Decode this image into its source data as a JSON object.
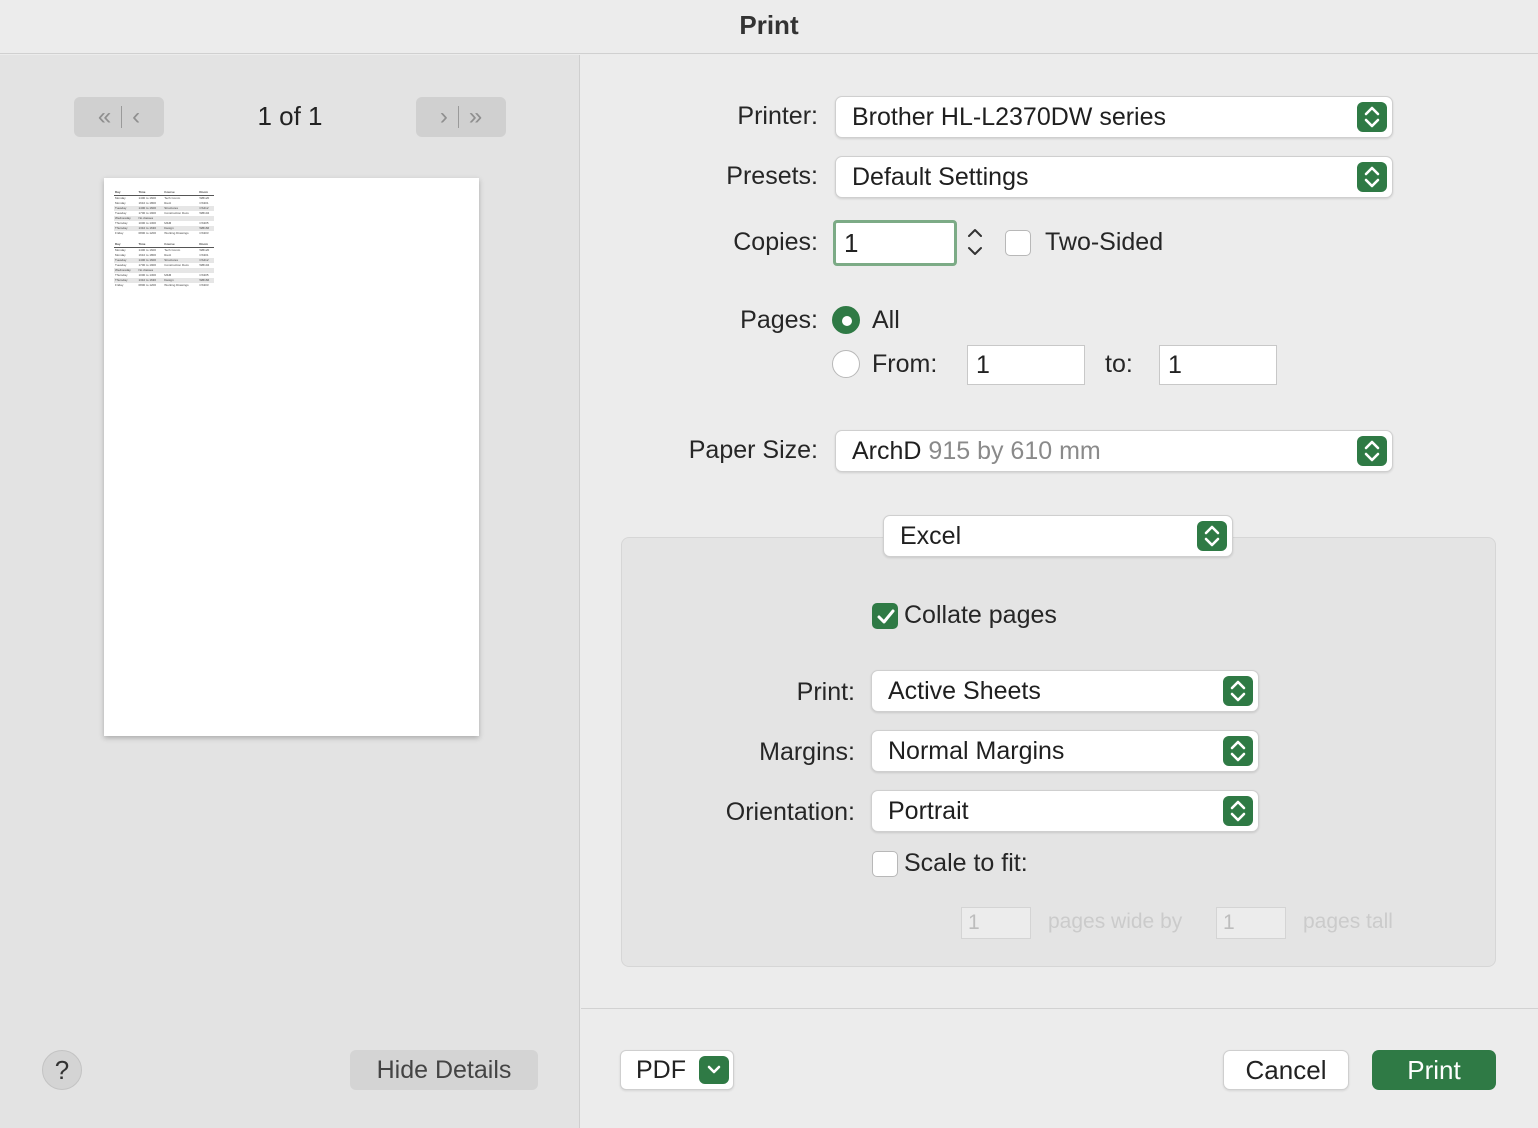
{
  "window": {
    "title": "Print"
  },
  "preview": {
    "page_indicator": "1 of 1",
    "table1": [
      [
        "Day",
        "Time",
        "Course",
        "Room"
      ],
      [
        "Monday",
        "1400 to 1600",
        "Tech Comm",
        "WB120"
      ],
      [
        "Monday",
        "1610 to 1800",
        "Revit",
        "CS301"
      ],
      [
        "Tuesday",
        "1400 to 1600",
        "Structures",
        "CS412"
      ],
      [
        "Tuesday",
        "1700 to 1900",
        "Construction Docs",
        "WB104"
      ],
      [
        "Wednesday",
        "No classes",
        "",
        ""
      ],
      [
        "Thursday",
        "1000 to 1300",
        "M&M",
        "CS305"
      ],
      [
        "Thursday",
        "1310 to 1630",
        "Design",
        "WB166"
      ],
      [
        "Friday",
        "0800 to 1200",
        "Working Drawings",
        "CS303"
      ]
    ],
    "table2": [
      [
        "Day",
        "Time",
        "Course",
        "Room"
      ],
      [
        "Monday",
        "1400 to 1600",
        "Tech Comm",
        "WB120"
      ],
      [
        "Monday",
        "1610 to 1800",
        "Revit",
        "CS301"
      ],
      [
        "Tuesday",
        "1400 to 1600",
        "Structures",
        "CS412"
      ],
      [
        "Tuesday",
        "1700 to 1900",
        "Construction Docs",
        "WB104"
      ],
      [
        "Wednesday",
        "No classes",
        "",
        ""
      ],
      [
        "Thursday",
        "1000 to 1300",
        "M&M",
        "CS305"
      ],
      [
        "Thursday",
        "1310 to 1630",
        "Design",
        "WB166"
      ],
      [
        "Friday",
        "0800 to 1200",
        "Working Drawings",
        "CS303"
      ]
    ]
  },
  "left_footer": {
    "help_label": "?",
    "hide_details_label": "Hide Details"
  },
  "form": {
    "printer_label": "Printer:",
    "printer_value": "Brother HL-L2370DW series",
    "presets_label": "Presets:",
    "presets_value": "Default Settings",
    "copies_label": "Copies:",
    "copies_value": "1",
    "two_sided_label": "Two-Sided",
    "pages_label": "Pages:",
    "pages_all": "All",
    "pages_from": "From:",
    "from_value": "1",
    "pages_to": "to:",
    "to_value": "1",
    "paper_size_label": "Paper Size:",
    "paper_size_name": "ArchD",
    "paper_size_dims": "915 by 610 mm"
  },
  "excel_section": {
    "dropdown_value": "Excel",
    "collate_label": "Collate pages",
    "print_label": "Print:",
    "print_value": "Active Sheets",
    "margins_label": "Margins:",
    "margins_value": "Normal Margins",
    "orientation_label": "Orientation:",
    "orientation_value": "Portrait",
    "scale_label": "Scale to fit:",
    "wide_value": "1",
    "wide_label": "pages wide by",
    "tall_value": "1",
    "tall_label": "pages tall"
  },
  "footer": {
    "pdf_label": "PDF",
    "cancel_label": "Cancel",
    "print_label": "Print"
  },
  "colors": {
    "accent": "#2f7a45"
  }
}
